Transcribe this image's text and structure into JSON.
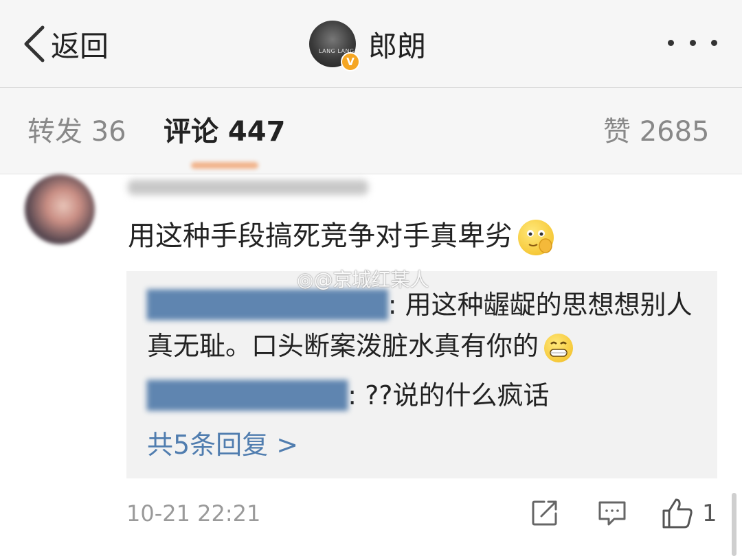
{
  "nav": {
    "back_label": "返回",
    "title": "郎朗",
    "avatar_text": "LANG LANG",
    "verified_mark": "V"
  },
  "tabs": {
    "reposts": "转发 36",
    "comments": "评论 447",
    "likes": "赞 2685"
  },
  "comment": {
    "text": "用这种手段搞死竞争对手真卑劣",
    "emoji": "thinking-face-emoji",
    "replies": [
      {
        "text": ": 用这种龌龊的思想想别人真无耻。口头断案泼脏水真有你的",
        "emoji": "grinning-face-emoji"
      },
      {
        "text": ": ??说的什么疯话"
      }
    ],
    "more_replies": "共5条回复 >",
    "timestamp": "10-21 22:21",
    "like_count": "1"
  },
  "watermark": "@京城红某人",
  "colors": {
    "bar_bg": "#f6f6f6",
    "link_blue": "#507daf",
    "badge_orange": "#f5a623"
  }
}
